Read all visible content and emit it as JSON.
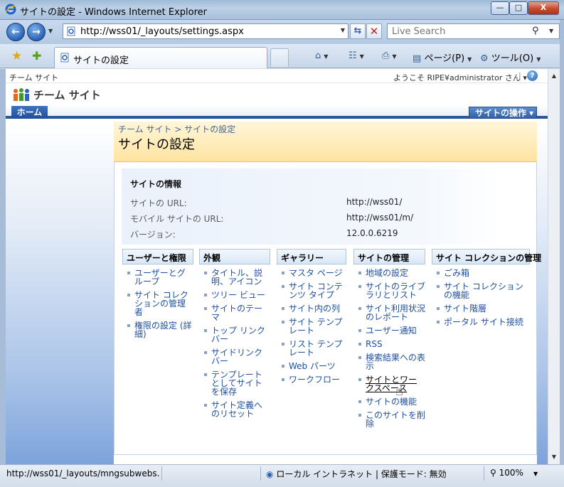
{
  "window": {
    "title": "サイトの設定 - Windows Internet Explorer",
    "min_glyph": "—",
    "max_glyph": "□",
    "close_glyph": "X"
  },
  "address_bar": {
    "url": "http://wss01/_layouts/settings.aspx",
    "search_placeholder": "Live Search"
  },
  "command_bar": {
    "tab_label": "サイトの設定",
    "page_menu": "ページ(P)",
    "tools_menu": "ツール(O)"
  },
  "sharepoint": {
    "site_link": "チーム サイト",
    "welcome": "ようこそ RIPE¥administrator さん ▾",
    "separator": "|",
    "help_glyph": "?",
    "site_title": "チーム サイト",
    "home_tab": "ホーム",
    "site_actions": "サイトの操作 ▾",
    "breadcrumb": "チーム サイト > サイトの設定",
    "page_title": "サイトの設定"
  },
  "site_info": {
    "heading": "サイトの情報",
    "rows": [
      {
        "label": "サイトの URL:",
        "value": "http://wss01/"
      },
      {
        "label": "モバイル サイトの URL:",
        "value": "http://wss01/m/"
      },
      {
        "label": "バージョン:",
        "value": "12.0.0.6219"
      }
    ]
  },
  "columns": [
    {
      "heading": "ユーザーと権限",
      "links": [
        "ユーザーとグループ",
        "サイト コレクションの管理者",
        "権限の設定 (詳細)"
      ]
    },
    {
      "heading": "外観",
      "links": [
        "タイトル、説明、アイコン",
        "ツリー ビュー",
        "サイトのテーマ",
        "トップ リンク バー",
        "サイドリンク バー",
        "テンプレートとしてサイトを保存",
        "サイト定義へのリセット"
      ]
    },
    {
      "heading": "ギャラリー",
      "links": [
        "マスタ ページ",
        "サイト コンテンツ タイプ",
        "サイト内の列",
        "サイト テンプレート",
        "リスト テンプレート",
        "Web パーツ",
        "ワークフロー"
      ]
    },
    {
      "heading": "サイトの管理",
      "links": [
        "地域の設定",
        "サイトのライブラリとリスト",
        "サイト利用状況のレポート",
        "ユーザー通知",
        "RSS",
        "検索結果への表示",
        "サイトとワークスペース",
        "サイトの機能",
        "このサイトを削除"
      ]
    },
    {
      "heading": "サイト コレクションの管理",
      "links": [
        "ごみ箱",
        "サイト コレクションの機能",
        "サイト階層",
        "ポータル サイト接続"
      ]
    }
  ],
  "status_bar": {
    "text": "http://wss01/_layouts/mngsubwebs.",
    "zone": "ローカル イントラネット | 保護モード: 無効",
    "zoom": "100%"
  },
  "colors": {
    "accent": "#2b5797",
    "link": "#2050a0",
    "title_band": "#ffe4a0"
  },
  "icons": [
    "ie-logo-icon",
    "back-icon",
    "forward-icon",
    "page-icon",
    "refresh-icon",
    "stop-icon",
    "search-icon",
    "favorites-star-icon",
    "add-favorite-icon",
    "home-icon",
    "feeds-icon",
    "print-icon",
    "page-menu-icon",
    "tools-gear-icon",
    "help-icon",
    "sharepoint-logo-icon",
    "globe-icon",
    "zoom-icon",
    "hand-cursor-icon"
  ]
}
